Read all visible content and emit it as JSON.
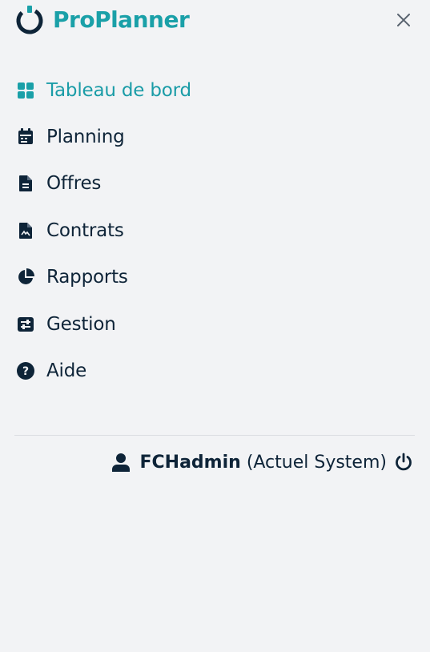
{
  "app": {
    "brand": "ProPlanner",
    "colors": {
      "accent": "#1aa0a8",
      "text": "#0e2438",
      "background": "#f2f3f5"
    }
  },
  "header": {
    "close_icon": "close-icon"
  },
  "nav": {
    "items": [
      {
        "label": "Tableau de bord",
        "icon": "dashboard-icon",
        "active": true
      },
      {
        "label": "Planning",
        "icon": "calendar-icon",
        "active": false
      },
      {
        "label": "Offres",
        "icon": "document-icon",
        "active": false
      },
      {
        "label": "Contrats",
        "icon": "contract-icon",
        "active": false
      },
      {
        "label": "Rapports",
        "icon": "pie-chart-icon",
        "active": false
      },
      {
        "label": "Gestion",
        "icon": "sliders-icon",
        "active": false
      },
      {
        "label": "Aide",
        "icon": "help-icon",
        "active": false
      }
    ]
  },
  "user": {
    "name": "FCHadmin",
    "system": "(Actuel System)",
    "icon": "user-icon",
    "logout_icon": "power-icon"
  }
}
